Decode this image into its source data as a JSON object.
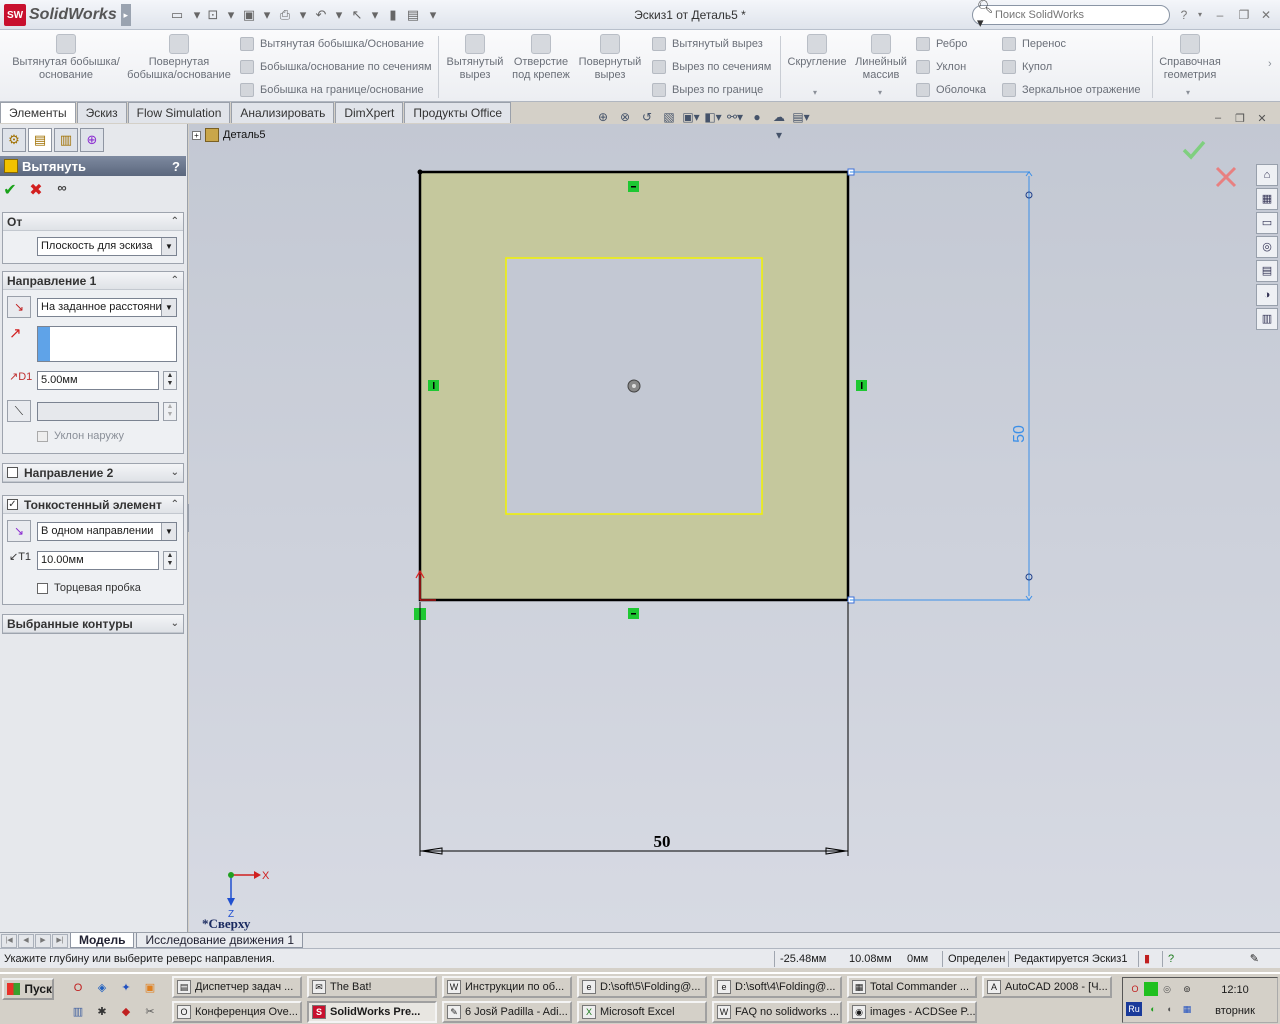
{
  "app": {
    "name": "SolidWorks",
    "logo_text": "SW",
    "doc_title": "Эскиз1 от Деталь5 *",
    "search_placeholder": "Поиск SolidWorks",
    "help_label": "?"
  },
  "ribbon": {
    "big": [
      {
        "label": "Вытянутая бобышка/основание",
        "icon": "extrude-boss-icon"
      },
      {
        "label": "Повернутая бобышка/основание",
        "icon": "revolve-boss-icon"
      },
      {
        "label": "Вытянутый вырез",
        "icon": "extrude-cut-icon"
      },
      {
        "label": "Отверстие под крепеж",
        "icon": "hole-wizard-icon"
      },
      {
        "label": "Повернутый вырез",
        "icon": "revolve-cut-icon"
      },
      {
        "label": "Скругление",
        "icon": "fillet-icon"
      },
      {
        "label": "Линейный массив",
        "icon": "linear-pattern-icon"
      },
      {
        "label": "Справочная геометрия",
        "icon": "reference-geometry-icon"
      }
    ],
    "small": [
      {
        "label": "Вытянутая бобышка/Основание",
        "icon": "swept-boss-icon"
      },
      {
        "label": "Бобышка/основание по сечениям",
        "icon": "loft-boss-icon"
      },
      {
        "label": "Бобышка на границе/основание",
        "icon": "boundary-boss-icon"
      },
      {
        "label": "Вытянутый вырез",
        "icon": "swept-cut-icon"
      },
      {
        "label": "Вырез по сечениям",
        "icon": "loft-cut-icon"
      },
      {
        "label": "Вырез по границе",
        "icon": "boundary-cut-icon"
      },
      {
        "label": "Ребро",
        "icon": "rib-icon"
      },
      {
        "label": "Уклон",
        "icon": "draft-icon"
      },
      {
        "label": "Оболочка",
        "icon": "shell-icon"
      },
      {
        "label": "Перенос",
        "icon": "wrap-icon"
      },
      {
        "label": "Купол",
        "icon": "dome-icon"
      },
      {
        "label": "Зеркальное отражение",
        "icon": "mirror-icon"
      }
    ]
  },
  "tabs": [
    "Элементы",
    "Эскиз",
    "Flow Simulation",
    "Анализировать",
    "DimXpert",
    "Продукты Office"
  ],
  "feature_tree": {
    "root": "Деталь5"
  },
  "property_manager": {
    "title": "Вытянуть",
    "help": "?",
    "groups": {
      "from": {
        "title": "От",
        "value": "Плоскость для эскиза"
      },
      "dir1": {
        "title": "Направление 1",
        "end_condition": "На заданное расстояние",
        "depth": "5.00мм",
        "draft_outward": "Уклон наружу"
      },
      "dir2": {
        "title": "Направление 2"
      },
      "thin": {
        "title": "Тонкостенный элемент",
        "type": "В одном направлении",
        "thickness": "10.00мм",
        "cap_ends": "Торцевая пробка"
      },
      "contours": {
        "title": "Выбранные контуры"
      }
    }
  },
  "sketch": {
    "dim_horizontal": "50",
    "dim_vertical": "50",
    "view_label": "*Сверху",
    "axis_x": "X",
    "axis_z": "Z",
    "colors": {
      "fill": "#c5c89d",
      "inner": "#f2f200",
      "dim": "#3b8fe8",
      "relation": "#1ec832"
    }
  },
  "bottom_tabs": [
    "Модель",
    "Исследование движения 1"
  ],
  "status": {
    "message": "Укажите глубину или выберите реверс направления.",
    "x": "-25.48мм",
    "y": "10.08мм",
    "z": "0мм",
    "state": "Определен",
    "editing": "Редактируется Эскиз1"
  },
  "taskbar": {
    "start": "Пуск",
    "row1": [
      "Диспетчер задач ...",
      "The Bat!",
      "Инструкции по об...",
      "D:\\soft\\5\\Folding@...",
      "D:\\soft\\4\\Folding@...",
      "Total Commander ...",
      "AutoCAD 2008 - [Ч..."
    ],
    "row2": [
      "Конференция Ove...",
      "SolidWorks Pre...",
      "6 Josй Padilla - Adi...",
      "Microsoft Excel",
      "FAQ no solidworks ...",
      "images - ACDSee P..."
    ],
    "lang": "Ru",
    "time": "12:10",
    "day": "вторник"
  }
}
